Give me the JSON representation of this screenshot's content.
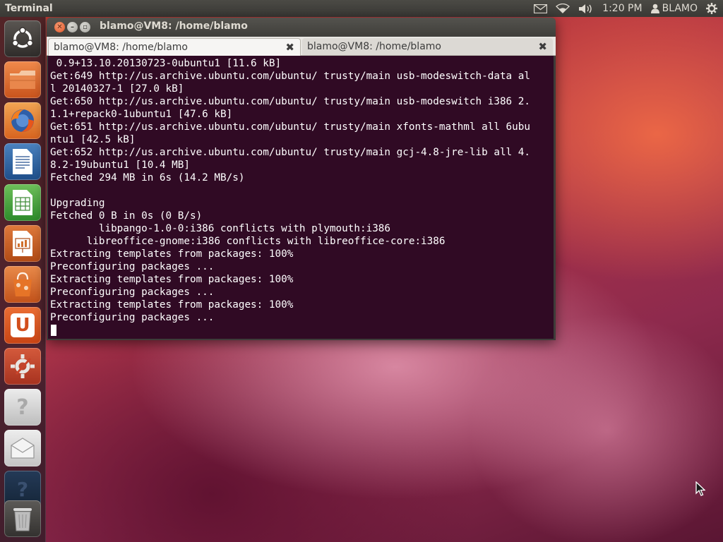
{
  "top_panel": {
    "app_name": "Terminal",
    "clock": "1:20 PM",
    "user": "BLAMO"
  },
  "launcher": {
    "items": [
      {
        "name": "dash-home",
        "icon": "ubuntu-logo-icon"
      },
      {
        "name": "home-folder",
        "icon": "folder-icon"
      },
      {
        "name": "firefox",
        "icon": "firefox-icon"
      },
      {
        "name": "libreoffice-writer",
        "icon": "writer-icon"
      },
      {
        "name": "libreoffice-calc",
        "icon": "calc-icon"
      },
      {
        "name": "libreoffice-impress",
        "icon": "impress-icon"
      },
      {
        "name": "software-center",
        "icon": "software-center-icon"
      },
      {
        "name": "ubuntu-one",
        "icon": "ubuntu-one-icon",
        "glyph": "U"
      },
      {
        "name": "system-settings",
        "icon": "settings-icon"
      },
      {
        "name": "help",
        "icon": "help-icon",
        "glyph": "?"
      },
      {
        "name": "mail",
        "icon": "mail-icon"
      },
      {
        "name": "workspace",
        "icon": "workspace-icon",
        "glyph": "?"
      },
      {
        "name": "trash",
        "icon": "trash-icon"
      }
    ]
  },
  "window": {
    "title": "blamo@VM8: /home/blamo",
    "tabs": [
      {
        "label": "blamo@VM8: /home/blamo",
        "active": true
      },
      {
        "label": "blamo@VM8: /home/blamo",
        "active": false
      }
    ],
    "terminal_output": " 0.9+13.10.20130723-0ubuntu1 [11.6 kB]\nGet:649 http://us.archive.ubuntu.com/ubuntu/ trusty/main usb-modeswitch-data al\nl 20140327-1 [27.0 kB]\nGet:650 http://us.archive.ubuntu.com/ubuntu/ trusty/main usb-modeswitch i386 2.\n1.1+repack0-1ubuntu1 [47.6 kB]\nGet:651 http://us.archive.ubuntu.com/ubuntu/ trusty/main xfonts-mathml all 6ubu\nntu1 [42.5 kB]\nGet:652 http://us.archive.ubuntu.com/ubuntu/ trusty/main gcj-4.8-jre-lib all 4.\n8.2-19ubuntu1 [10.4 MB]\nFetched 294 MB in 6s (14.2 MB/s)\n\nUpgrading\nFetched 0 B in 0s (0 B/s)\n        libpango-1.0-0:i386 conflicts with plymouth:i386\n      libreoffice-gnome:i386 conflicts with libreoffice-core:i386\nExtracting templates from packages: 100%\nPreconfiguring packages ...\nExtracting templates from packages: 100%\nPreconfiguring packages ...\nExtracting templates from packages: 100%\nPreconfiguring packages ..."
  },
  "colors": {
    "terminal_bg": "#300a24",
    "terminal_fg": "#ffffff",
    "panel_bg": "#3c3b37",
    "close_button": "#e0552a"
  }
}
